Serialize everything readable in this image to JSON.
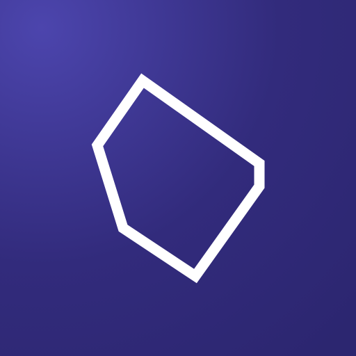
{
  "artwork": {
    "subject": "pentagon-outline-icon",
    "colors": {
      "background_highlight": "#4c45ad",
      "background_base": "#322b7c",
      "background_shadow": "#2c2670",
      "outline": "#ffffff"
    }
  }
}
